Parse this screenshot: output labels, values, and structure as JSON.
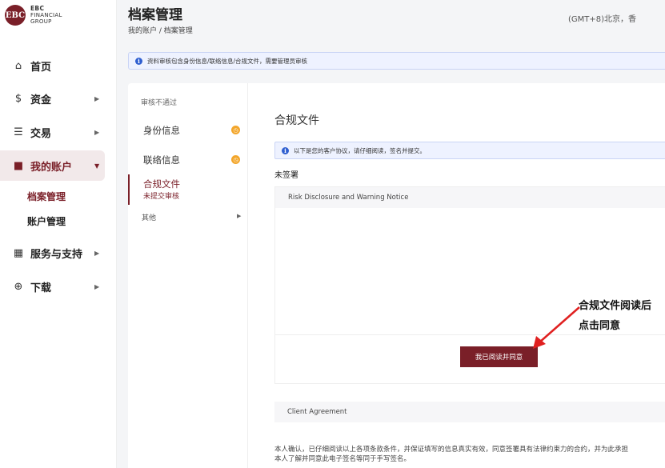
{
  "brand": {
    "mark": "EBC",
    "line1": "EBC",
    "line2": "FINANCIAL",
    "line3": "GROUP",
    "accent": "#7a1f28"
  },
  "nav": {
    "items": [
      {
        "label": "首页",
        "icon": "home-icon"
      },
      {
        "label": "资金",
        "icon": "dollar-icon"
      },
      {
        "label": "交易",
        "icon": "trade-icon"
      },
      {
        "label": "我的账户",
        "icon": "folder-icon"
      },
      {
        "label": "服务与支持",
        "icon": "grid-icon"
      },
      {
        "label": "下载",
        "icon": "download-icon"
      }
    ],
    "sub_items": [
      {
        "label": "档案管理"
      },
      {
        "label": "账户管理"
      }
    ]
  },
  "header": {
    "title": "档案管理",
    "breadcrumb": "我的账户 / 档案管理",
    "timezone": "(GMT+8)北京，香"
  },
  "notice": {
    "text": "资料审核包含身份信息/联络信息/合规文件，需要管理员审核"
  },
  "sub_nav": {
    "heading": "审核不通过",
    "items": [
      {
        "label": "身份信息"
      },
      {
        "label": "联络信息"
      }
    ],
    "active": {
      "label": "合规文件",
      "status": "未提交审核"
    },
    "other": "其他"
  },
  "content": {
    "title": "合规文件",
    "notice": "以下是您的客户协议，请仔细阅读，签名并提交。",
    "status": "未签署",
    "doc1_title": "Risk Disclosure and Warning Notice",
    "agree_button": "我已阅读并同意",
    "doc2_title": "Client Agreement",
    "confirm_line1": "本人确认，已仔细阅读以上各项条款条件，并保证填写的信息真实有效，同意签署具有法律约束力的合约，并为此承担",
    "confirm_line2": "本人了解并同意此电子签名等同于手写签名。"
  },
  "annotation": {
    "line1": "合规文件阅读后",
    "line2": "点击同意"
  }
}
